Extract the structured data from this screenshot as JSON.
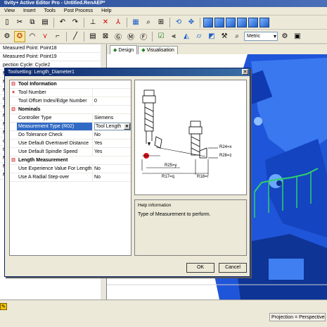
{
  "window": {
    "title": "tivity+ Active Editor Pro - Untitled.RenAEP*"
  },
  "menu": {
    "items": [
      "View",
      "Insert",
      "Tools",
      "Post Process",
      "Help"
    ]
  },
  "toolbar": {
    "units": "Metric"
  },
  "left_panel": {
    "rows": [
      "Measured Point: Point18",
      "Measured Point: Point19",
      "pection Cycle: Cycle2",
      "Me",
      "Me",
      "Me",
      "ofc",
      "Mo",
      "Mo",
      "Me",
      "Me",
      "ofc",
      "tool",
      "Mo",
      "Mo",
      "Me"
    ]
  },
  "view_tabs": [
    {
      "label": "Design"
    },
    {
      "label": "Visualisation"
    }
  ],
  "dialog": {
    "title": "Toolsetting: Length_Diameter1",
    "sections": [
      {
        "title": "Tool Information",
        "rows": [
          {
            "name": "Tool Number",
            "value": "",
            "marker": "×"
          },
          {
            "name": "Tool Offset Index/Edge Number",
            "value": "0",
            "marker": ""
          }
        ]
      },
      {
        "title": "Nominals",
        "rows": [
          {
            "name": "Controller Type",
            "value": "Siemens",
            "marker": ""
          },
          {
            "name": "Measurement Type (R02)",
            "value": "Tool Length",
            "marker": "",
            "highlight": true
          },
          {
            "name": "Do Tolerance Check",
            "value": "No",
            "marker": ""
          },
          {
            "name": "Use Default Overtravel Distance",
            "value": "Yes",
            "marker": ""
          },
          {
            "name": "Use Default Spindle Speed",
            "value": "Yes",
            "marker": ""
          }
        ]
      },
      {
        "title": "Length Measurement",
        "rows": [
          {
            "name": "Use Experience Value For Length",
            "value": "No",
            "marker": ""
          },
          {
            "name": "Use A Radial Step-over",
            "value": "No",
            "marker": ""
          }
        ]
      }
    ],
    "diagram_labels": {
      "r24": "R24=x",
      "r26": "R26=z",
      "r25": "R25=y",
      "r17": "R17=q",
      "r18": "R18=r"
    },
    "help": {
      "title": "Help information",
      "text": "Type of Measurement to perform."
    },
    "buttons": {
      "ok": "OK",
      "cancel": "Cancel"
    }
  },
  "status": {
    "projection": "Projection = Perspective"
  },
  "colors": {
    "accent": "#0a246a",
    "model_blue": "#1d4fd8",
    "highlight": "#316ac5"
  }
}
